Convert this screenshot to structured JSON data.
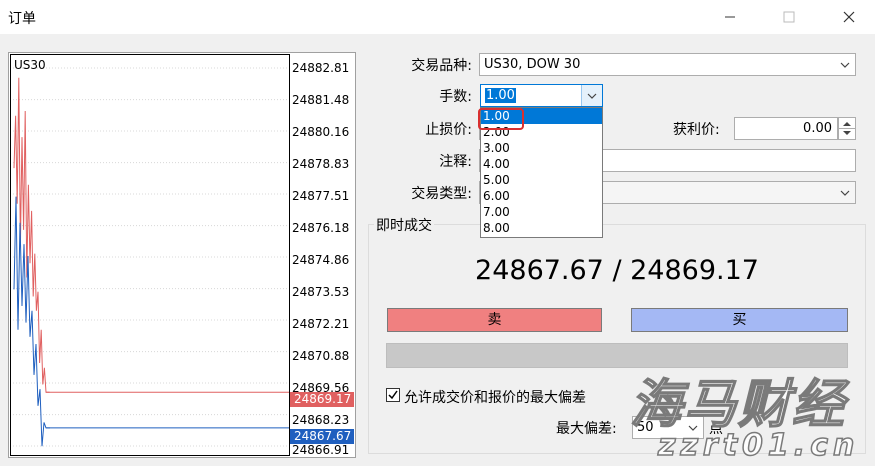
{
  "window": {
    "title": "订单"
  },
  "chart": {
    "symbol": "US30",
    "price_levels": [
      "24882.81",
      "24881.48",
      "24880.16",
      "24878.83",
      "24877.51",
      "24876.18",
      "24874.86",
      "24873.53",
      "24872.21",
      "24870.88",
      "24869.56",
      "24868.23",
      "24866.91"
    ],
    "ask_tag": "24869.17",
    "bid_tag": "24867.67",
    "ask_color": "#e06060",
    "bid_color": "#1f5fbf"
  },
  "form": {
    "symbol_label": "交易品种:",
    "symbol_value": "US30, DOW 30",
    "lots_label": "手数:",
    "lots_value": "1.00",
    "lots_options": [
      "1.00",
      "2.00",
      "3.00",
      "4.00",
      "5.00",
      "6.00",
      "7.00",
      "8.00"
    ],
    "stoploss_label": "止损价:",
    "takeprofit_label": "获利价:",
    "takeprofit_value": "0.00",
    "comment_label": "注释:",
    "type_label": "交易类型:"
  },
  "instant": {
    "group_label": "即时成交",
    "quote": "24867.67 / 24869.17",
    "sell_label": "卖",
    "buy_label": "买",
    "sell_color": "#f08080",
    "buy_color": "#a4b8f4",
    "deviation_checkbox_label": "允许成交价和报价的最大偏差",
    "max_deviation_label": "最大偏差:",
    "max_deviation_value": "50",
    "points_label": "点"
  },
  "watermark": {
    "main": "海马财经",
    "url": "zzrt01.cn"
  }
}
